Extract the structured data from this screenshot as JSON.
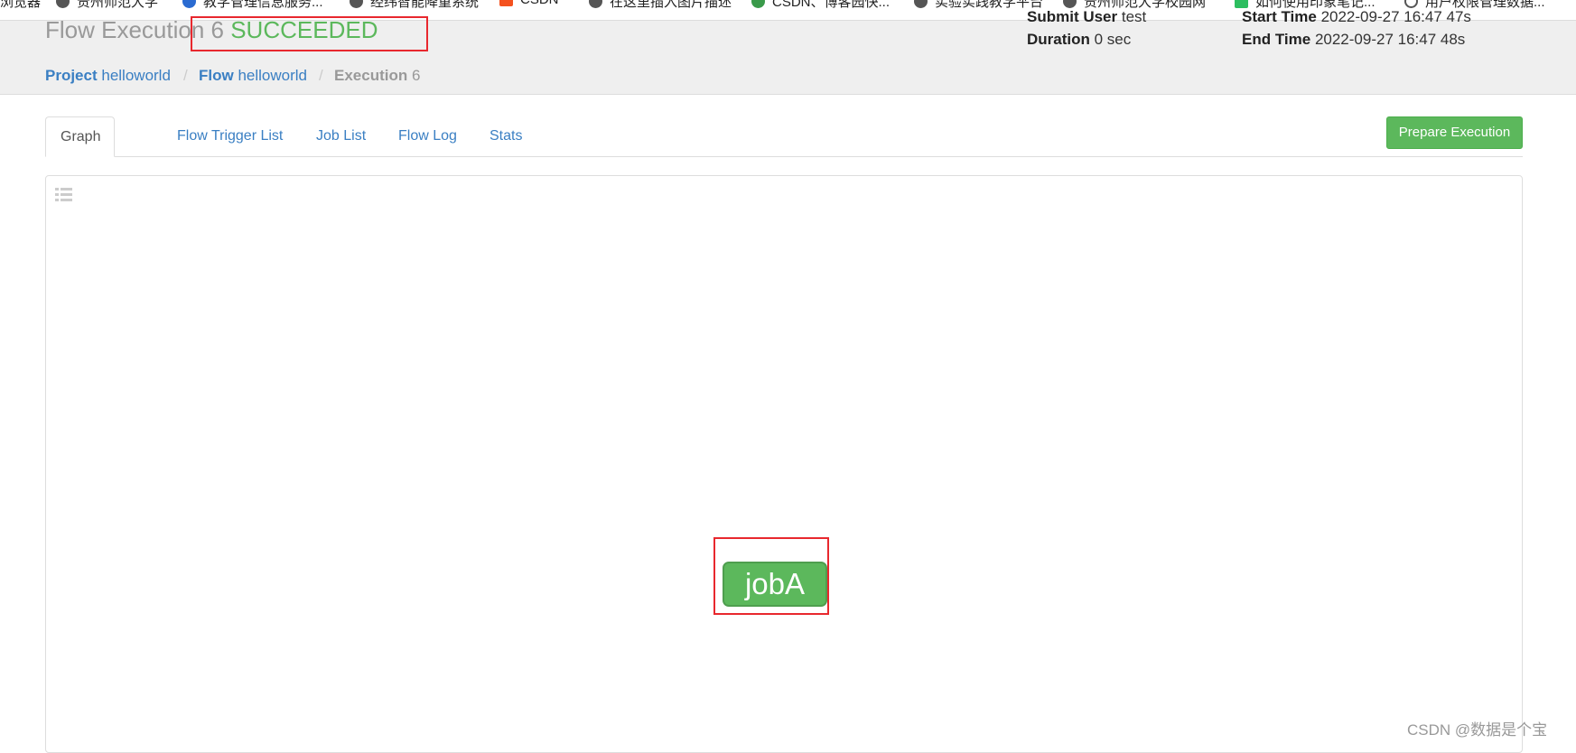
{
  "bookmarks": [
    "浏览器",
    "贵州师范大学",
    "教学管理信息服务...",
    "经纬智能降重系统",
    "CSDN",
    "在这里插入图片描述",
    "CSDN、博客园快...",
    "实验实践教学平台",
    "贵州师范大学校园网",
    "如何使用印象笔记...",
    "用户权限管理数据..."
  ],
  "header": {
    "title": "Flow Execution 6",
    "status": "SUCCEEDED",
    "status_color": "#5cb85c",
    "submit_user_label": "Submit User",
    "submit_user": "test",
    "start_time_label": "Start Time",
    "start_time": "2022-09-27 16:47 47s",
    "duration_label": "Duration",
    "duration": "0 sec",
    "end_time_label": "End Time",
    "end_time": "2022-09-27 16:47 48s"
  },
  "breadcrumb": {
    "project_label": "Project",
    "project": "helloworld",
    "flow_label": "Flow",
    "flow": "helloworld",
    "execution_label": "Execution",
    "execution": "6"
  },
  "tabs": [
    "Graph",
    "Flow Trigger List",
    "Job List",
    "Flow Log",
    "Stats"
  ],
  "prepare_button": "Prepare Execution",
  "graph": {
    "node": "jobA",
    "node_color": "#5cb85c"
  },
  "watermark": "CSDN @数据是个宝"
}
